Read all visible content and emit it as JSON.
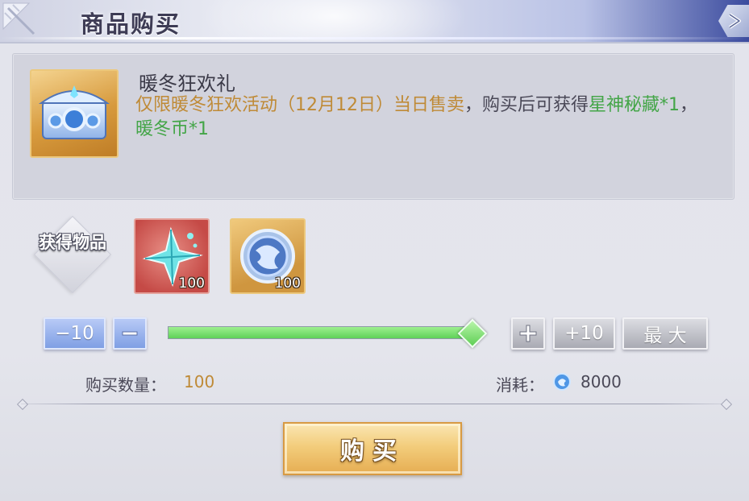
{
  "header": {
    "title": "商品购买",
    "close_icon": "close-chevron-icon"
  },
  "item": {
    "icon": "treasure-chest-icon",
    "name": "暖冬狂欢礼",
    "desc_part1": "仅限暖冬狂欢活动（12月12日）当日售卖",
    "desc_part2": "，购买后可获得",
    "desc_reward1": "星神秘藏*1",
    "desc_sep": "，",
    "desc_reward2": "暖冬币*1"
  },
  "rewards": {
    "label": "获得物品",
    "items": [
      {
        "icon": "crystal-star-icon",
        "count": "100",
        "frame_color": "#c54a46"
      },
      {
        "icon": "winter-coin-icon",
        "count": "100",
        "frame_color": "#cf963f"
      }
    ]
  },
  "quantity": {
    "minus10_label": "−10",
    "minus_icon": "minus-icon",
    "plus_icon": "plus-icon",
    "plus10_label": "+10",
    "max_label": "最 大",
    "slider_value_fraction": 1.0,
    "slider_color": "#5fd158"
  },
  "summary": {
    "qty_label": "购买数量：",
    "qty_value": "100",
    "cost_label": "消耗：",
    "cost_icon": "blue-gem-icon",
    "cost_value": "8000"
  },
  "buy_button": {
    "label": "购买"
  },
  "colors": {
    "accent_gold": "#bf8a36",
    "accent_green": "#43a547",
    "button_blue": "#7f9fe4"
  }
}
